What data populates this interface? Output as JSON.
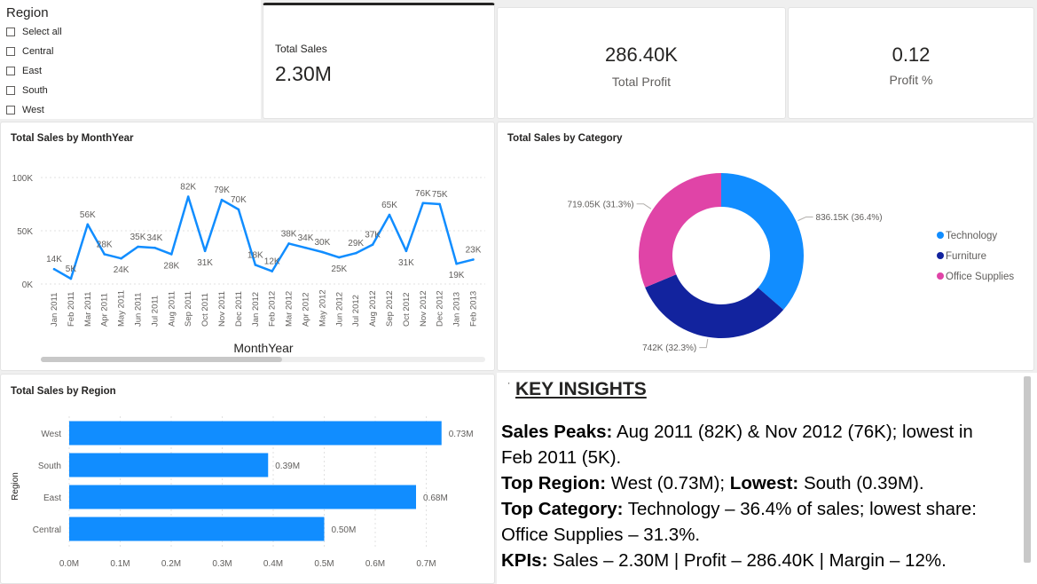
{
  "slicer": {
    "title": "Region",
    "items": [
      "Select all",
      "Central",
      "East",
      "South",
      "West"
    ]
  },
  "kpis": {
    "total_sales": {
      "label": "Total Sales",
      "value": "2.30M"
    },
    "total_profit": {
      "label": "Total Profit",
      "value": "286.40K"
    },
    "profit_pct": {
      "label": "Profit %",
      "value": "0.12"
    }
  },
  "line_chart": {
    "title": "Total Sales by MonthYear",
    "xlabel": "MonthYear"
  },
  "donut_chart": {
    "title": "Total Sales by Category"
  },
  "bar_chart": {
    "title": "Total Sales by Region",
    "ylabel": "Region"
  },
  "insights": {
    "heading": "KEY INSIGHTS",
    "l1_label": "Sales Peaks:",
    "l1_text": " Aug 2011 (82K) & Nov 2012 (76K); lowest in",
    "l2_text": "Feb 2011 (5K).",
    "l3_label": "Top Region:",
    "l3_text": " West (0.73M); ",
    "l3_label2": "Lowest:",
    "l3_text2": " South (0.39M).",
    "l4_label": "Top Category:",
    "l4_text": " Technology – 36.4% of sales; lowest share:",
    "l5_text": "Office Supplies – 31.3%.",
    "l6_label": "KPIs:",
    "l6_text": " Sales – 2.30M | Profit – 286.40K | Margin – 12%."
  },
  "colors": {
    "accent": "#118DFF",
    "furniture": "#12239E",
    "office_supplies": "#E044A7"
  },
  "chart_data": [
    {
      "type": "line",
      "title": "Total Sales by MonthYear",
      "xlabel": "MonthYear",
      "ylabel": "",
      "ylim": [
        0,
        100000
      ],
      "yticks": [
        "0K",
        "50K",
        "100K"
      ],
      "x": [
        "Jan 2011",
        "Feb 2011",
        "Mar 2011",
        "Apr 2011",
        "May 2011",
        "Jun 2011",
        "Jul 2011",
        "Aug 2011",
        "Sep 2011",
        "Oct 2011",
        "Nov 2011",
        "Dec 2011",
        "Jan 2012",
        "Feb 2012",
        "Mar 2012",
        "Apr 2012",
        "May 2012",
        "Jun 2012",
        "Jul 2012",
        "Aug 2012",
        "Sep 2012",
        "Oct 2012",
        "Nov 2012",
        "Dec 2012",
        "Jan 2013",
        "Feb 2013"
      ],
      "tick_labels": [
        "Jan 2011",
        "Feb 2011",
        "Mar 2011",
        "Apr 2011",
        "May 2011",
        "Jun 2011",
        "Jul 2011",
        "Aug 2011",
        "Sep 2011",
        "Oct 2011",
        "Nov 2011",
        "Dec 2011",
        "Jan 2012",
        "Feb 2012",
        "Mar 2012",
        "Apr 2012",
        "May 2012",
        "Jun 2012",
        "Jul 2012",
        "Aug 2012",
        "Sep 2012",
        "Oct 2012",
        "Nov 2012",
        "Dec 2012",
        "Jan 2013",
        "Feb 2013"
      ],
      "values": [
        14000,
        5000,
        56000,
        28000,
        24000,
        35000,
        34000,
        28000,
        82000,
        31000,
        79000,
        70000,
        18000,
        12000,
        38000,
        34000,
        30000,
        25000,
        29000,
        37000,
        65000,
        31000,
        76000,
        75000,
        19000,
        23000
      ],
      "labels": [
        "14K",
        "5K",
        "56K",
        "28K",
        "24K",
        "35K",
        "34K",
        "28K",
        "82K",
        "31K",
        "79K",
        "70K",
        "18K",
        "12K",
        "38K",
        "34K",
        "30K",
        "25K",
        "29K",
        "37K",
        "65K",
        "31K",
        "76K",
        "75K",
        "19K",
        "23K"
      ],
      "label_pos": [
        "above",
        "above",
        "above",
        "above",
        "below",
        "above",
        "above",
        "below",
        "above",
        "below",
        "above",
        "above",
        "above",
        "above",
        "above",
        "above",
        "above",
        "below",
        "above",
        "above",
        "above",
        "below",
        "above",
        "above",
        "below",
        "above"
      ]
    },
    {
      "type": "pie",
      "title": "Total Sales by Category",
      "categories": [
        "Technology",
        "Furniture",
        "Office Supplies"
      ],
      "values": [
        836150,
        742000,
        719050
      ],
      "data_labels": [
        "836.15K (36.4%)",
        "742K (32.3%)",
        "719.05K (31.3%)"
      ],
      "legend": "right"
    },
    {
      "type": "bar",
      "title": "Total Sales by Region",
      "ylabel": "Region",
      "categories": [
        "West",
        "South",
        "East",
        "Central"
      ],
      "values": [
        0.73,
        0.39,
        0.68,
        0.5
      ],
      "data_labels": [
        "0.73M",
        "0.39M",
        "0.68M",
        "0.50M"
      ],
      "xlim": [
        0,
        0.8
      ],
      "xticks": [
        "0.0M",
        "0.1M",
        "0.2M",
        "0.3M",
        "0.4M",
        "0.5M",
        "0.6M",
        "0.7M"
      ]
    }
  ]
}
